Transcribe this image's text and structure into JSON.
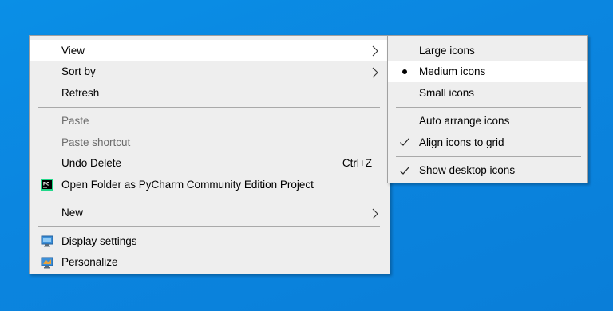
{
  "context_menu": {
    "items": [
      {
        "label": "View",
        "shortcut": "",
        "submenu": true,
        "disabled": false,
        "highlighted": true
      },
      {
        "label": "Sort by",
        "shortcut": "",
        "submenu": true,
        "disabled": false,
        "highlighted": false
      },
      {
        "label": "Refresh",
        "shortcut": "",
        "submenu": false,
        "disabled": false,
        "highlighted": false
      },
      {
        "label": "Paste",
        "shortcut": "",
        "submenu": false,
        "disabled": true,
        "highlighted": false
      },
      {
        "label": "Paste shortcut",
        "shortcut": "",
        "submenu": false,
        "disabled": true,
        "highlighted": false
      },
      {
        "label": "Undo Delete",
        "shortcut": "Ctrl+Z",
        "submenu": false,
        "disabled": false,
        "highlighted": false
      },
      {
        "label": "Open Folder as PyCharm Community Edition Project",
        "shortcut": "",
        "submenu": false,
        "disabled": false,
        "highlighted": false,
        "icon": "pycharm-icon"
      },
      {
        "label": "New",
        "shortcut": "",
        "submenu": true,
        "disabled": false,
        "highlighted": false
      },
      {
        "label": "Display settings",
        "shortcut": "",
        "submenu": false,
        "disabled": false,
        "highlighted": false,
        "icon": "display-settings-icon"
      },
      {
        "label": "Personalize",
        "shortcut": "",
        "submenu": false,
        "disabled": false,
        "highlighted": false,
        "icon": "personalize-icon"
      }
    ]
  },
  "view_submenu": {
    "items": [
      {
        "label": "Large icons",
        "mark": "none",
        "highlighted": false
      },
      {
        "label": "Medium icons",
        "mark": "bullet",
        "highlighted": true
      },
      {
        "label": "Small icons",
        "mark": "none",
        "highlighted": false
      },
      {
        "label": "Auto arrange icons",
        "mark": "none",
        "highlighted": false
      },
      {
        "label": "Align icons to grid",
        "mark": "check",
        "highlighted": false
      },
      {
        "label": "Show desktop icons",
        "mark": "check",
        "highlighted": false
      }
    ]
  },
  "colors": {
    "desktop_background": "#0a86e0",
    "menu_background": "#eeeeee",
    "highlight": "#ffffff",
    "disabled_text": "#6d6d6d"
  }
}
